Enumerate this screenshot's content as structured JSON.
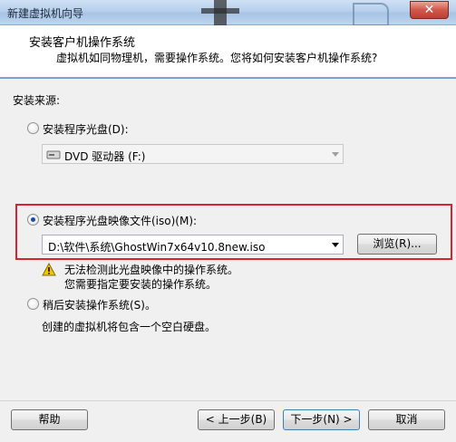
{
  "window": {
    "title": "新建虚拟机向导",
    "close_glyph": "✕"
  },
  "header": {
    "title": "安装客户机操作系统",
    "subtitle": "虚拟机如同物理机，需要操作系统。您将如何安装客户机操作系统?"
  },
  "source": {
    "label": "安装来源:",
    "disc_option": {
      "label": "安装程序光盘(D):",
      "selected": false
    },
    "disc_combo": {
      "value": "DVD 驱动器 (F:)",
      "icon": "dvd-drive-icon",
      "enabled": false
    },
    "iso_option": {
      "label": "安装程序光盘映像文件(iso)(M):",
      "selected": true
    },
    "iso_combo": {
      "value": "D:\\软件\\系统\\GhostWin7x64v10.8new.iso",
      "enabled": true
    },
    "browse_label": "浏览(R)...",
    "warning": {
      "icon": "warning-icon",
      "line1": "无法检测此光盘映像中的操作系统。",
      "line2": "您需要指定要安装的操作系统。"
    },
    "later_option": {
      "label": "稍后安装操作系统(S)。",
      "selected": false
    },
    "later_desc": "创建的虚拟机将包含一个空白硬盘。"
  },
  "footer": {
    "help": "帮助",
    "back": "< 上一步(B)",
    "next": "下一步(N) >",
    "cancel": "取消"
  },
  "colors": {
    "highlight_box": "#d9232e",
    "radio_dot": "#1c4f99"
  }
}
